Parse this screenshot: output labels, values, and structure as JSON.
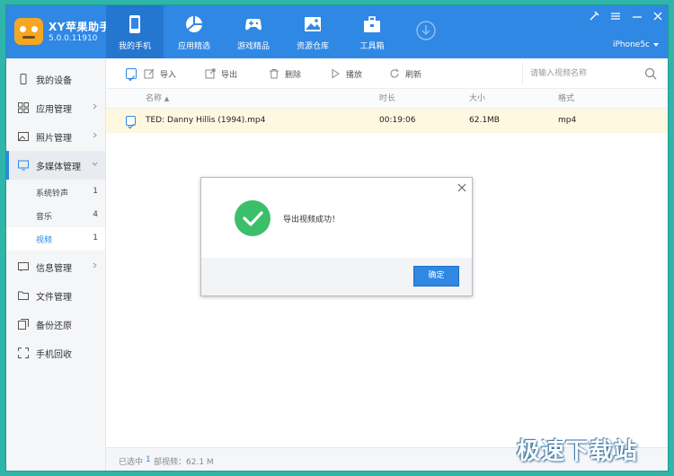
{
  "app": {
    "name": "XY苹果助手",
    "version": "5.0.0.11910"
  },
  "nav_tabs": [
    {
      "id": "my-phone",
      "label": "我的手机",
      "icon": "phone-icon",
      "active": true
    },
    {
      "id": "apps",
      "label": "应用精选",
      "icon": "pie-chart-icon",
      "active": false
    },
    {
      "id": "games",
      "label": "游戏精品",
      "icon": "gamepad-icon",
      "active": false
    },
    {
      "id": "resources",
      "label": "资源仓库",
      "icon": "image-icon",
      "active": false
    },
    {
      "id": "toolbox",
      "label": "工具箱",
      "icon": "toolbox-icon",
      "active": false
    }
  ],
  "device": {
    "name": "iPhone5c"
  },
  "sidebar": {
    "items": [
      {
        "label": "我的设备",
        "icon": "phone-outline-icon"
      },
      {
        "label": "应用管理",
        "icon": "grid-icon"
      },
      {
        "label": "照片管理",
        "icon": "photo-icon"
      },
      {
        "label": "多媒体管理",
        "icon": "monitor-icon"
      },
      {
        "label": "信息管理",
        "icon": "message-icon"
      },
      {
        "label": "文件管理",
        "icon": "folder-icon"
      },
      {
        "label": "备份还原",
        "icon": "backup-icon"
      },
      {
        "label": "手机回收",
        "icon": "recycle-icon"
      }
    ],
    "media_sub": [
      {
        "label": "系统铃声",
        "count": "1"
      },
      {
        "label": "音乐",
        "count": "4"
      },
      {
        "label": "视频",
        "count": "1"
      }
    ]
  },
  "toolbar": {
    "import": "导入",
    "export": "导出",
    "delete": "删除",
    "play": "播放",
    "refresh": "刷新",
    "search_placeholder": "请输入视频名称"
  },
  "table": {
    "headers": {
      "name": "名称",
      "duration": "时长",
      "size": "大小",
      "format": "格式"
    },
    "rows": [
      {
        "name": "TED: Danny Hillis (1994).mp4",
        "duration": "00:19:06",
        "size": "62.1MB",
        "format": "mp4"
      }
    ]
  },
  "status": {
    "prefix": "已选中",
    "count": "1",
    "suffix": "部视频：62.1 M"
  },
  "dialog": {
    "message": "导出视频成功！",
    "ok_label": "确定"
  },
  "watermark": "极速下载站",
  "colors": {
    "accent": "#2f88e4",
    "success": "#3bbf6a",
    "selected_row": "#fff8e0",
    "frame": "#2fb5a9"
  }
}
